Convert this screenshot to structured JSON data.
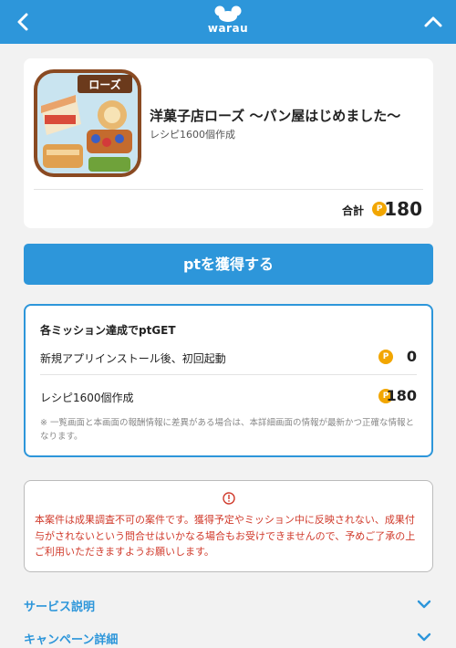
{
  "header": {
    "logo_text": "warau",
    "back_icon": "chevron-left-icon",
    "collapse_icon": "chevron-up-icon",
    "bg_color": "#2d96da"
  },
  "app": {
    "title": "洋菓子店ローズ 〜パン屋はじめました〜",
    "subtitle": "レシピ1600個作成",
    "total_label": "合計",
    "total_points": "180",
    "coin_symbol": "P"
  },
  "cta": {
    "label": "ptを獲得する"
  },
  "missions": {
    "heading": "各ミッション達成でptGET",
    "items": [
      {
        "label": "新規アプリインストール後、初回起動",
        "points": "0"
      },
      {
        "label": "レシピ1600個作成",
        "points": "180"
      }
    ],
    "note": "※ 一覧画面と本画面の報酬情報に差異がある場合は、本詳細画面の情報が最新かつ正確な情報となります。"
  },
  "warning": {
    "icon": "info-circle-icon",
    "text": "本案件は成果調査不可の案件です。獲得予定やミッション中に反映されない、成果付与がされないという問合せはいかなる場合もお受けできませんので、予めご了承の上ご利用いただきますようお願いします。",
    "color": "#d03a2b"
  },
  "sections": [
    {
      "label": "サービス説明"
    },
    {
      "label": "キャンペーン詳細"
    }
  ],
  "colors": {
    "accent": "#2d96da",
    "coin": "#f2a600",
    "page_bg": "#f2f2f2"
  }
}
